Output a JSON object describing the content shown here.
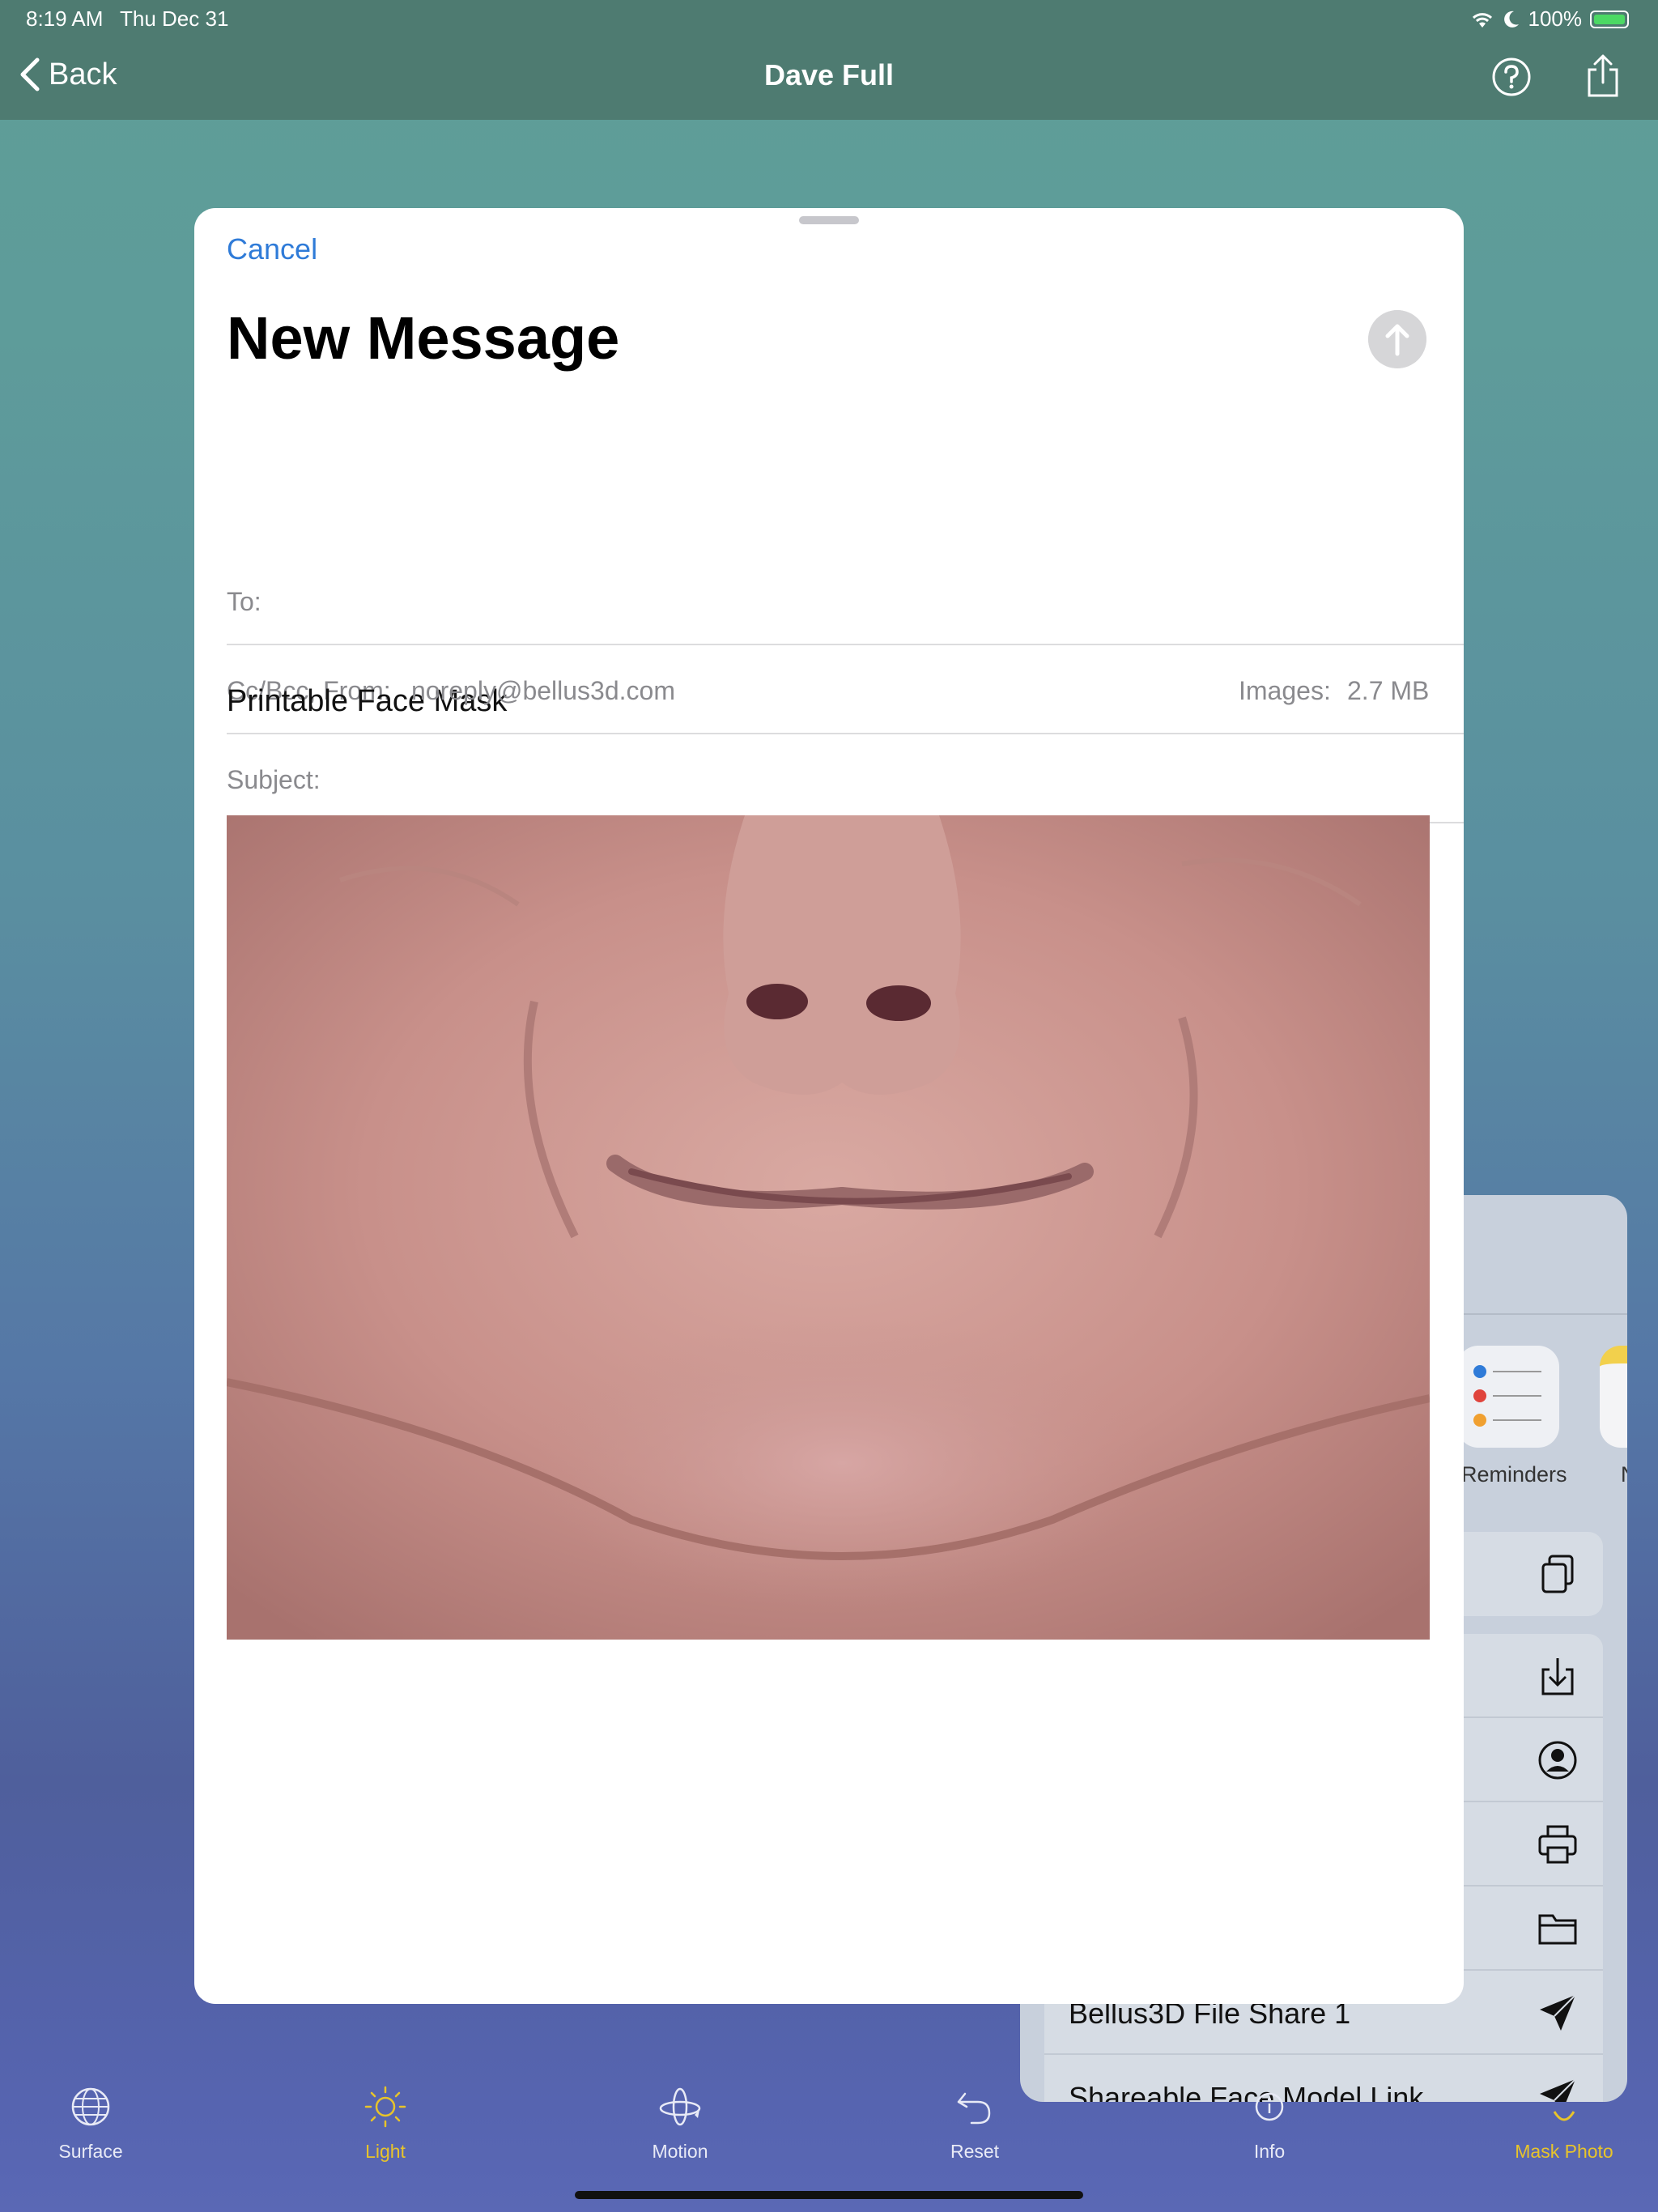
{
  "status_bar": {
    "time": "8:19 AM",
    "date": "Thu Dec 31",
    "battery": "100%"
  },
  "nav": {
    "back_label": "Back",
    "title": "Dave Full"
  },
  "compose": {
    "cancel_label": "Cancel",
    "title": "New Message",
    "to_label": "To:",
    "ccbcc_label": "Cc/Bcc, From:",
    "from_value": "noreply@bellus3d.com",
    "images_label": "Images:",
    "images_value": "2.7 MB",
    "subject_label": "Subject:",
    "body_text": "Printable Face Mask"
  },
  "share_sheet": {
    "apps": [
      {
        "label": "Reminders",
        "icon": "reminders-icon"
      },
      {
        "label": "N",
        "icon": "notes-icon"
      }
    ],
    "actions": [
      {
        "label": "",
        "icon": "copy-icon"
      },
      {
        "label": "",
        "icon": "save-download-icon"
      },
      {
        "label": "",
        "icon": "contact-icon"
      },
      {
        "label": "",
        "icon": "print-icon"
      },
      {
        "label": "",
        "icon": "folder-icon"
      },
      {
        "label": "Bellus3D File Share 1",
        "icon": "send-arrow-icon"
      },
      {
        "label": "Shareable Face Model Link",
        "icon": "send-arrow-icon"
      }
    ]
  },
  "tab_bar": {
    "items": [
      {
        "label": "Surface",
        "icon": "globe-icon",
        "active": false
      },
      {
        "label": "Light",
        "icon": "sun-icon",
        "active": true
      },
      {
        "label": "Motion",
        "icon": "motion-icon",
        "active": false
      },
      {
        "label": "Reset",
        "icon": "undo-icon",
        "active": false
      },
      {
        "label": "Info",
        "icon": "info-icon",
        "active": false
      },
      {
        "label": "Mask Photo",
        "icon": "mask-icon",
        "active": true
      }
    ]
  },
  "colors": {
    "nav_bg": "#4e7b71",
    "accent_blue": "#2f7bd8",
    "tab_active": "#e8c42a"
  }
}
